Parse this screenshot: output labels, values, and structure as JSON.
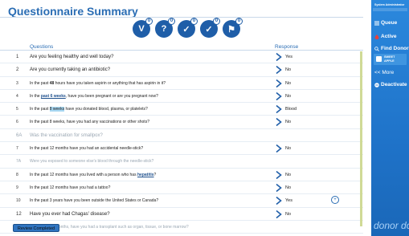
{
  "page": {
    "title": "Questionnaire Summary"
  },
  "toolbar": {
    "icons": [
      {
        "name": "vitals-icon",
        "glyph": "V",
        "badge": "0"
      },
      {
        "name": "questionnaire-icon",
        "glyph": "?",
        "badge": "0"
      },
      {
        "name": "eligibility-icon",
        "glyph": "✓",
        "badge": "0"
      },
      {
        "name": "check-icon",
        "glyph": "✓",
        "badge": "0"
      },
      {
        "name": "flag-icon",
        "glyph": "⚑",
        "badge": "0"
      }
    ]
  },
  "table": {
    "headers": {
      "questions": "Questions",
      "response": "Response"
    },
    "rows": [
      {
        "num": "1",
        "big": true,
        "dim": false,
        "q_pre": "Are you feeling healthy and well today?",
        "q_mark": "",
        "q_post": "",
        "mark_style": "",
        "response": "Yes",
        "chevron": true,
        "info": false
      },
      {
        "num": "2",
        "big": true,
        "dim": false,
        "q_pre": "Are you currently taking an antibiotic?",
        "q_mark": "",
        "q_post": "",
        "mark_style": "",
        "response": "No",
        "chevron": true,
        "info": false
      },
      {
        "num": "3",
        "big": false,
        "dim": false,
        "q_pre": "In the past ",
        "q_mark": "48",
        "q_post": " hours have you taken aspirin or anything that has aspirin in it?",
        "mark_style": "bu",
        "response": "No",
        "chevron": true,
        "info": false
      },
      {
        "num": "4",
        "big": false,
        "dim": false,
        "q_pre": "In the ",
        "q_mark": "past 6 weeks",
        "q_post": ", have you been pregnant or are you pregnant now?",
        "mark_style": "ul",
        "response": "No",
        "chevron": true,
        "info": false
      },
      {
        "num": "5",
        "big": false,
        "dim": false,
        "q_pre": "In the past ",
        "q_mark": "8 weeks",
        "q_post": " have you donated blood, plasma, or platelets?",
        "mark_style": "hl",
        "response": "Blood",
        "chevron": true,
        "info": false
      },
      {
        "num": "6",
        "big": false,
        "dim": false,
        "q_pre": "In the past 8 weeks, have you had any vaccinations or other shots?",
        "q_mark": "",
        "q_post": "",
        "mark_style": "",
        "response": "No",
        "chevron": true,
        "info": false
      },
      {
        "num": "6A",
        "big": true,
        "dim": true,
        "q_pre": "Was the vaccination for smallpox?",
        "q_mark": "",
        "q_post": "",
        "mark_style": "",
        "response": "",
        "chevron": false,
        "info": false
      },
      {
        "num": "7",
        "big": false,
        "dim": false,
        "q_pre": "In the past 12 months have you had an accidental needle-stick?",
        "q_mark": "",
        "q_post": "",
        "mark_style": "",
        "response": "No",
        "chevron": true,
        "info": false
      },
      {
        "num": "7A",
        "big": false,
        "dim": true,
        "q_pre": "Were you exposed to someone else's blood through the needle-stick?",
        "q_mark": "",
        "q_post": "",
        "mark_style": "",
        "response": "",
        "chevron": false,
        "info": false
      },
      {
        "num": "8",
        "big": false,
        "dim": false,
        "q_pre": "In the past 12 months have you lived with a person who has ",
        "q_mark": "hepatitis",
        "q_post": "?",
        "mark_style": "ul",
        "response": "No",
        "chevron": true,
        "info": false
      },
      {
        "num": "9",
        "big": false,
        "dim": false,
        "q_pre": "In the past 12 months have you had a tattoo?",
        "q_mark": "",
        "q_post": "",
        "mark_style": "",
        "response": "No",
        "chevron": true,
        "info": false
      },
      {
        "num": "10",
        "big": false,
        "dim": false,
        "q_pre": "In the past 3 years have you been outside the United States or Canada?",
        "q_mark": "",
        "q_post": "",
        "mark_style": "",
        "response": "Yes",
        "chevron": true,
        "info": true
      },
      {
        "num": "12",
        "big": true,
        "dim": false,
        "q_pre": "Have you ever had Chagas' disease?",
        "q_mark": "",
        "q_post": "",
        "mark_style": "",
        "response": "No",
        "chevron": true,
        "info": false
      },
      {
        "num": "13",
        "big": false,
        "dim": true,
        "q_pre": "In the past 12 months, have you had a transplant such as organ, tissue, or bone marrow?",
        "q_mark": "",
        "q_post": "",
        "mark_style": "",
        "response": "",
        "chevron": false,
        "info": false
      }
    ]
  },
  "footer": {
    "review_label": "Review Completed"
  },
  "sidebar": {
    "system_label": "System Administrator",
    "queue": "Queue",
    "active": "Active",
    "find_donor": "Find Donor",
    "user_line1": "SWEET",
    "user_line2": "APPLE",
    "more": "<< More",
    "deactivate": "Deactivate",
    "logo_text": "donor do"
  },
  "colors": {
    "accent": "#2a6db4",
    "sidebar": "#1f73c9",
    "icon_bg": "#1f5ea8",
    "highlight": "#a7d7f2"
  }
}
